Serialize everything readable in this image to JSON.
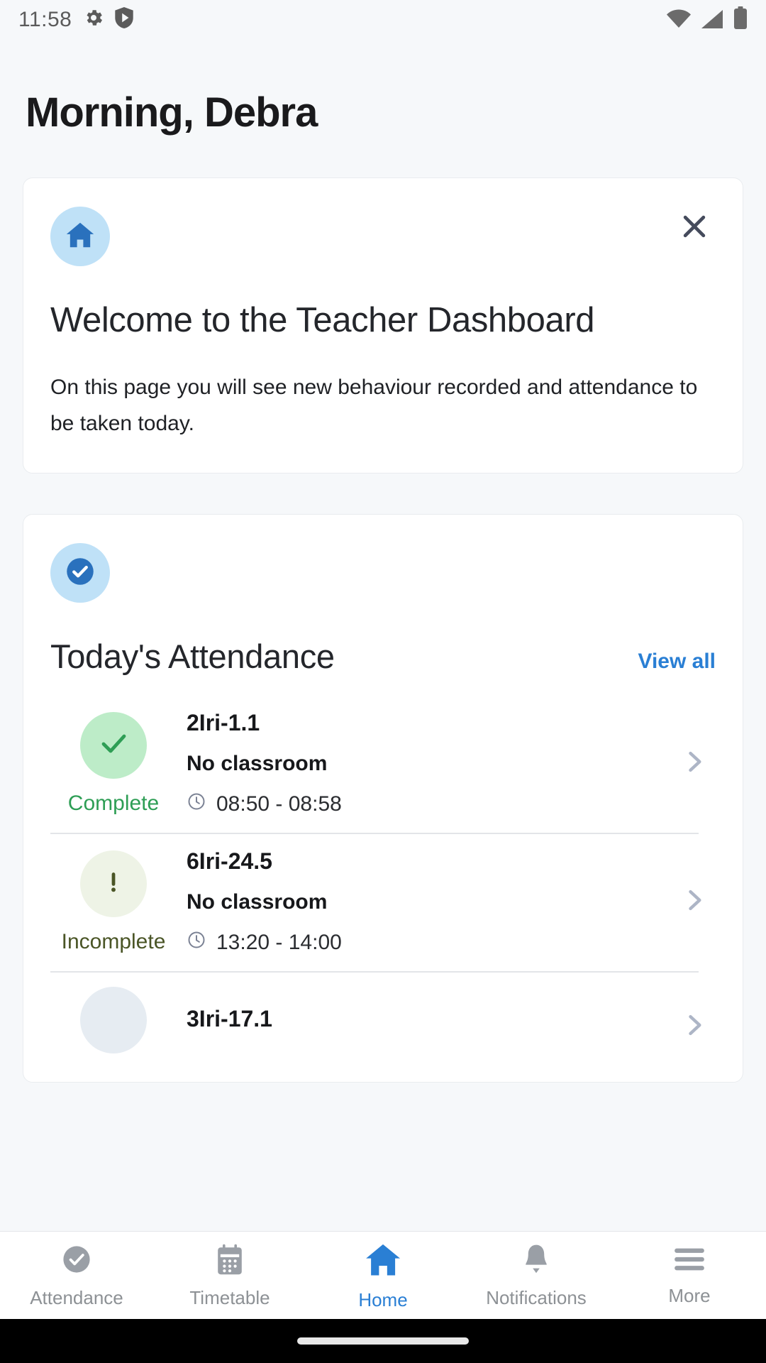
{
  "statusbar": {
    "time": "11:58",
    "left_icons": [
      "gear-icon",
      "shield-play-icon"
    ],
    "right_icons": [
      "wifi-icon",
      "cellular-signal-icon",
      "battery-icon"
    ]
  },
  "header": {
    "greeting": "Morning, Debra"
  },
  "welcome_card": {
    "icon": "home-icon",
    "close_icon": "close-icon",
    "title": "Welcome to the Teacher Dashboard",
    "body": "On this page you will see new behaviour recorded and attendance to be taken today."
  },
  "attendance_card": {
    "icon": "check-circle-icon",
    "title": "Today's Attendance",
    "view_all_label": "View all",
    "rows": [
      {
        "status_label": "Complete",
        "status_icon": "check-icon",
        "status_kind": "complete",
        "name": "2Iri-1.1",
        "room": "No classroom",
        "time": "08:50 - 08:58",
        "time_icon": "clock-icon",
        "chevron": "chevron-right-icon"
      },
      {
        "status_label": "Incomplete",
        "status_icon": "exclamation-icon",
        "status_kind": "incomplete",
        "name": "6Iri-24.5",
        "room": "No classroom",
        "time": "13:20 - 14:00",
        "time_icon": "clock-icon",
        "chevron": "chevron-right-icon"
      },
      {
        "status_label": "",
        "status_icon": "",
        "status_kind": "pending",
        "name": "3Iri-17.1",
        "room": "",
        "time": "",
        "time_icon": "clock-icon",
        "chevron": "chevron-right-icon"
      }
    ]
  },
  "bottom_nav": {
    "items": [
      {
        "label": "Attendance",
        "icon": "check-circle-icon",
        "active": false
      },
      {
        "label": "Timetable",
        "icon": "calendar-icon",
        "active": false
      },
      {
        "label": "Home",
        "icon": "home-icon",
        "active": true
      },
      {
        "label": "Notifications",
        "icon": "bell-icon",
        "active": false
      },
      {
        "label": "More",
        "icon": "hamburger-icon",
        "active": false
      }
    ]
  },
  "colors": {
    "page_background": "#f6f8fa",
    "card_background": "#ffffff",
    "accent_blue": "#2a7fd4",
    "complete_green": "#2e9e55",
    "incomplete_olive": "#4a5526",
    "muted_gray": "#8d9195"
  }
}
